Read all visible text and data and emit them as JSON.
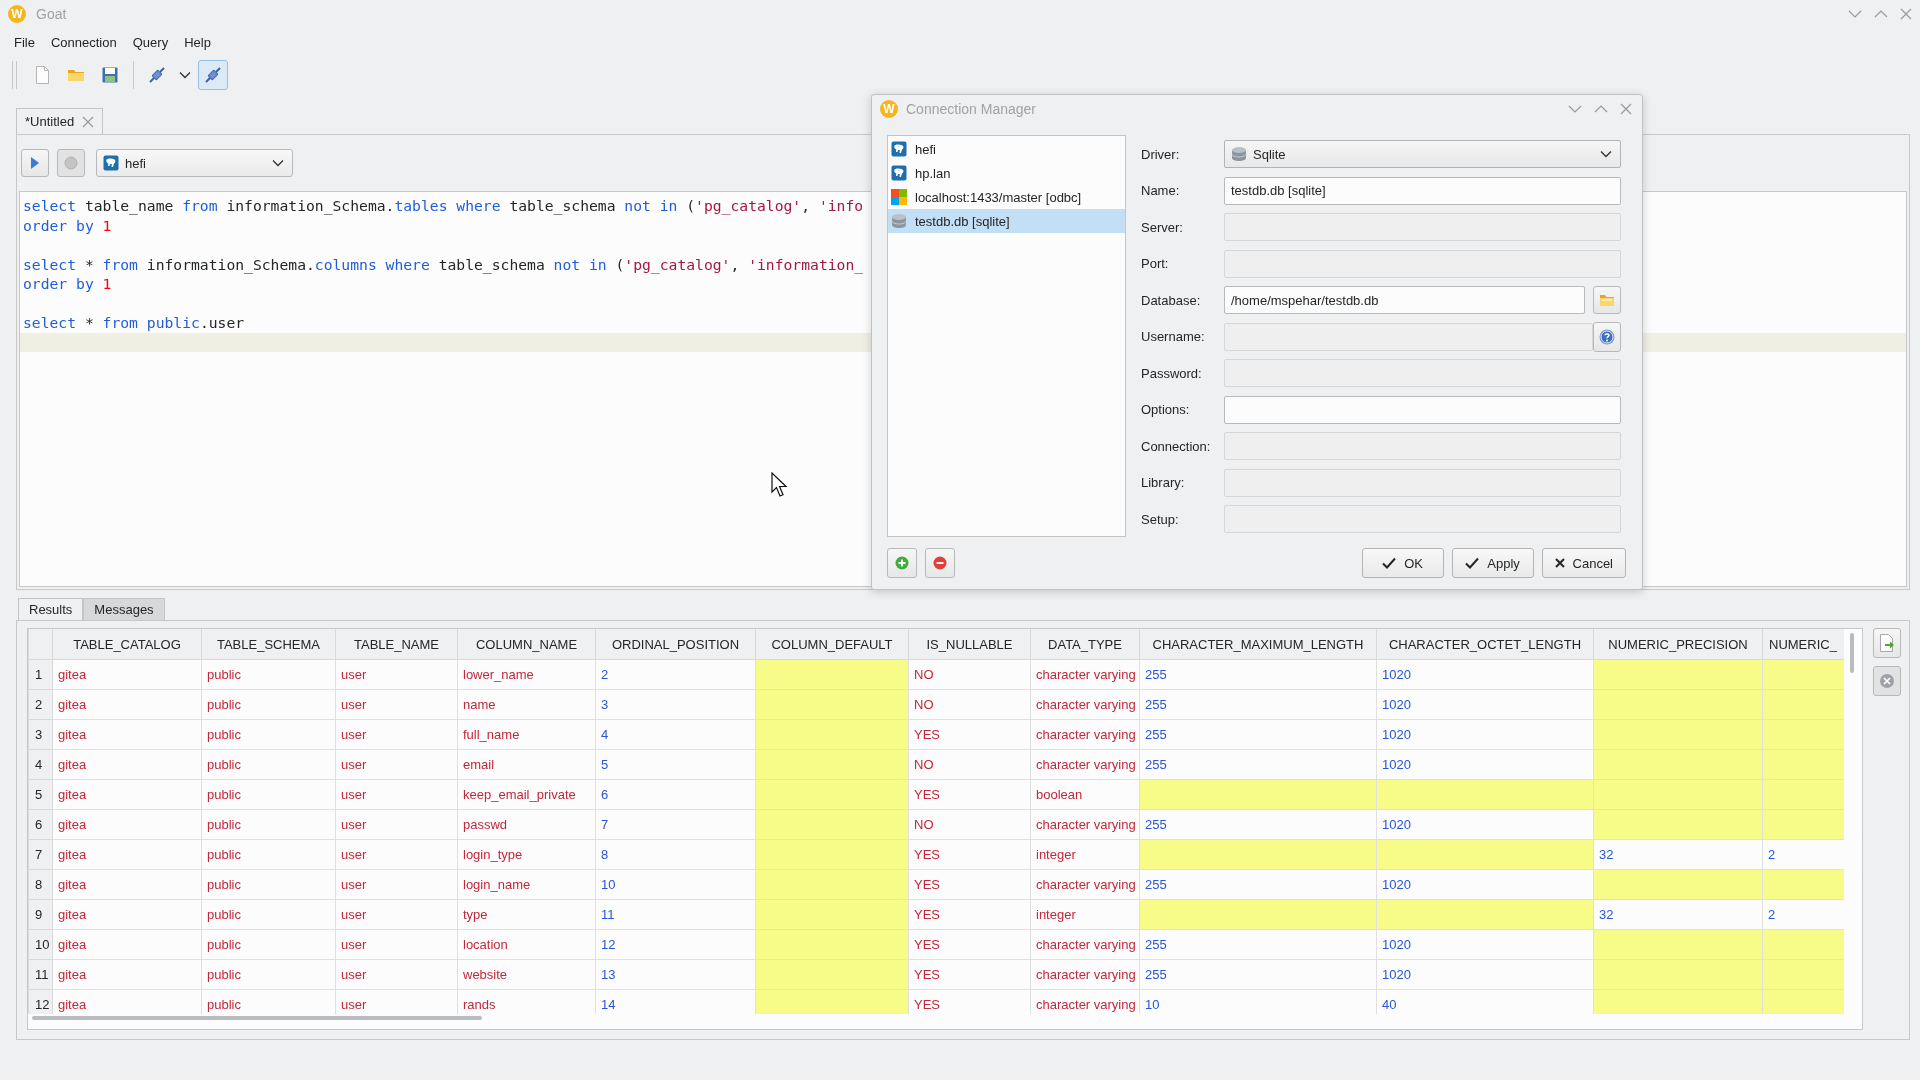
{
  "window": {
    "logo": "W",
    "title": "Goat"
  },
  "menu": [
    "File",
    "Connection",
    "Query",
    "Help"
  ],
  "toolbar": [
    {
      "kind": "new",
      "pressed": false
    },
    {
      "kind": "open",
      "pressed": false
    },
    {
      "kind": "save",
      "pressed": false
    },
    {
      "kind": "connect",
      "pressed": false
    },
    {
      "kind": "dropdown",
      "pressed": false
    },
    {
      "kind": "connect",
      "pressed": true
    }
  ],
  "document_tabs": [
    {
      "label": "*Untitled",
      "selected": true
    }
  ],
  "query_bar": {
    "connection": {
      "label": "hefi",
      "kind": "postgres"
    }
  },
  "editor": {
    "lines": [
      {
        "kind": "code",
        "current": false,
        "tokens": [
          {
            "kind": "keyword",
            "text": "select"
          },
          {
            "kind": "plain",
            "text": " table_name "
          },
          {
            "kind": "keyword",
            "text": "from"
          },
          {
            "kind": "plain",
            "text": " information_Schema."
          },
          {
            "kind": "keyword",
            "text": "tables where"
          },
          {
            "kind": "plain",
            "text": " table_schema "
          },
          {
            "kind": "keyword",
            "text": "not in"
          },
          {
            "kind": "plain",
            "text": " ("
          },
          {
            "kind": "string",
            "text": "'pg_catalog'"
          },
          {
            "kind": "plain",
            "text": ", "
          },
          {
            "kind": "string",
            "text": "'info"
          }
        ]
      },
      {
        "kind": "code",
        "current": false,
        "tokens": [
          {
            "kind": "keyword",
            "text": "order by"
          },
          {
            "kind": "number",
            "text": " 1"
          }
        ]
      },
      {
        "kind": "blank",
        "current": false
      },
      {
        "kind": "code",
        "current": false,
        "tokens": [
          {
            "kind": "keyword",
            "text": "select"
          },
          {
            "kind": "plain",
            "text": " * "
          },
          {
            "kind": "keyword",
            "text": "from"
          },
          {
            "kind": "plain",
            "text": " information_Schema."
          },
          {
            "kind": "keyword",
            "text": "columns where"
          },
          {
            "kind": "plain",
            "text": " table_schema "
          },
          {
            "kind": "keyword",
            "text": "not in"
          },
          {
            "kind": "plain",
            "text": " ("
          },
          {
            "kind": "string",
            "text": "'pg_catalog'"
          },
          {
            "kind": "plain",
            "text": ", "
          },
          {
            "kind": "string",
            "text": "'information_"
          }
        ]
      },
      {
        "kind": "code",
        "current": false,
        "tokens": [
          {
            "kind": "keyword",
            "text": "order by"
          },
          {
            "kind": "number",
            "text": " 1"
          }
        ]
      },
      {
        "kind": "blank",
        "current": false
      },
      {
        "kind": "code",
        "current": false,
        "tokens": [
          {
            "kind": "keyword",
            "text": "select"
          },
          {
            "kind": "plain",
            "text": " * "
          },
          {
            "kind": "keyword",
            "text": "from public"
          },
          {
            "kind": "plain",
            "text": ".user"
          }
        ]
      },
      {
        "kind": "blank",
        "current": true
      }
    ]
  },
  "result_tabs": [
    {
      "label": "Results",
      "selected": true
    },
    {
      "label": "Messages",
      "selected": false
    }
  ],
  "table": {
    "columns": [
      {
        "label": "TABLE_CATALOG",
        "kind": "text"
      },
      {
        "label": "TABLE_SCHEMA",
        "kind": "text"
      },
      {
        "label": "TABLE_NAME",
        "kind": "text"
      },
      {
        "label": "COLUMN_NAME",
        "kind": "text"
      },
      {
        "label": "ORDINAL_POSITION",
        "kind": "number"
      },
      {
        "label": "COLUMN_DEFAULT",
        "kind": "text"
      },
      {
        "label": "IS_NULLABLE",
        "kind": "text"
      },
      {
        "label": "DATA_TYPE",
        "kind": "text"
      },
      {
        "label": "CHARACTER_MAXIMUM_LENGTH",
        "kind": "number"
      },
      {
        "label": "CHARACTER_OCTET_LENGTH",
        "kind": "number"
      },
      {
        "label": "NUMERIC_PRECISION",
        "kind": "number"
      },
      {
        "label": "NUMERIC_",
        "kind": "number"
      }
    ],
    "rows": [
      {
        "number": "1",
        "cells": [
          "gitea",
          "public",
          "user",
          "lower_name",
          "2",
          null,
          "NO",
          "character varying",
          "255",
          "1020",
          null,
          null
        ]
      },
      {
        "number": "2",
        "cells": [
          "gitea",
          "public",
          "user",
          "name",
          "3",
          null,
          "NO",
          "character varying",
          "255",
          "1020",
          null,
          null
        ]
      },
      {
        "number": "3",
        "cells": [
          "gitea",
          "public",
          "user",
          "full_name",
          "4",
          null,
          "YES",
          "character varying",
          "255",
          "1020",
          null,
          null
        ]
      },
      {
        "number": "4",
        "cells": [
          "gitea",
          "public",
          "user",
          "email",
          "5",
          null,
          "NO",
          "character varying",
          "255",
          "1020",
          null,
          null
        ]
      },
      {
        "number": "5",
        "cells": [
          "gitea",
          "public",
          "user",
          "keep_email_private",
          "6",
          null,
          "YES",
          "boolean",
          null,
          null,
          null,
          null
        ]
      },
      {
        "number": "6",
        "cells": [
          "gitea",
          "public",
          "user",
          "passwd",
          "7",
          null,
          "NO",
          "character varying",
          "255",
          "1020",
          null,
          null
        ]
      },
      {
        "number": "7",
        "cells": [
          "gitea",
          "public",
          "user",
          "login_type",
          "8",
          null,
          "YES",
          "integer",
          null,
          null,
          "32",
          "2"
        ]
      },
      {
        "number": "8",
        "cells": [
          "gitea",
          "public",
          "user",
          "login_name",
          "10",
          null,
          "YES",
          "character varying",
          "255",
          "1020",
          null,
          null
        ]
      },
      {
        "number": "9",
        "cells": [
          "gitea",
          "public",
          "user",
          "type",
          "11",
          null,
          "YES",
          "integer",
          null,
          null,
          "32",
          "2"
        ]
      },
      {
        "number": "10",
        "cells": [
          "gitea",
          "public",
          "user",
          "location",
          "12",
          null,
          "YES",
          "character varying",
          "255",
          "1020",
          null,
          null
        ]
      },
      {
        "number": "11",
        "cells": [
          "gitea",
          "public",
          "user",
          "website",
          "13",
          null,
          "YES",
          "character varying",
          "255",
          "1020",
          null,
          null
        ]
      },
      {
        "number": "12",
        "cells": [
          "gitea",
          "public",
          "user",
          "rands",
          "14",
          null,
          "YES",
          "character varying",
          "10",
          "40",
          null,
          null
        ]
      }
    ]
  },
  "dialog": {
    "logo": "W",
    "title": "Connection Manager",
    "connections": [
      {
        "label": "hefi",
        "kind": "postgres",
        "selected": false
      },
      {
        "label": "hp.lan",
        "kind": "postgres",
        "selected": false
      },
      {
        "label": "localhost:1433/master [odbc]",
        "kind": "odbc",
        "selected": false
      },
      {
        "label": "testdb.db [sqlite]",
        "kind": "sqlite",
        "selected": true
      }
    ],
    "fields": [
      {
        "label": "Driver:",
        "kind": "combo",
        "value": "Sqlite",
        "disabled": false
      },
      {
        "label": "Name:",
        "kind": "text",
        "value": "testdb.db [sqlite]",
        "disabled": false
      },
      {
        "label": "Server:",
        "kind": "text",
        "disabled": true
      },
      {
        "label": "Port:",
        "kind": "text",
        "disabled": true
      },
      {
        "label": "Database:",
        "kind": "path",
        "value": "/home/mspehar/testdb.db",
        "disabled": false
      },
      {
        "label": "Username:",
        "kind": "help",
        "disabled": true
      },
      {
        "label": "Password:",
        "kind": "text",
        "disabled": true
      },
      {
        "label": "Options:",
        "kind": "text",
        "disabled": false
      },
      {
        "label": "Connection:",
        "kind": "text",
        "disabled": true
      },
      {
        "label": "Library:",
        "kind": "text",
        "disabled": true
      },
      {
        "label": "Setup:",
        "kind": "text",
        "disabled": true
      }
    ],
    "buttons": [
      {
        "label": "OK",
        "kind": "ok"
      },
      {
        "label": "Apply",
        "kind": "apply"
      },
      {
        "label": "Cancel",
        "kind": "cancel"
      }
    ]
  }
}
